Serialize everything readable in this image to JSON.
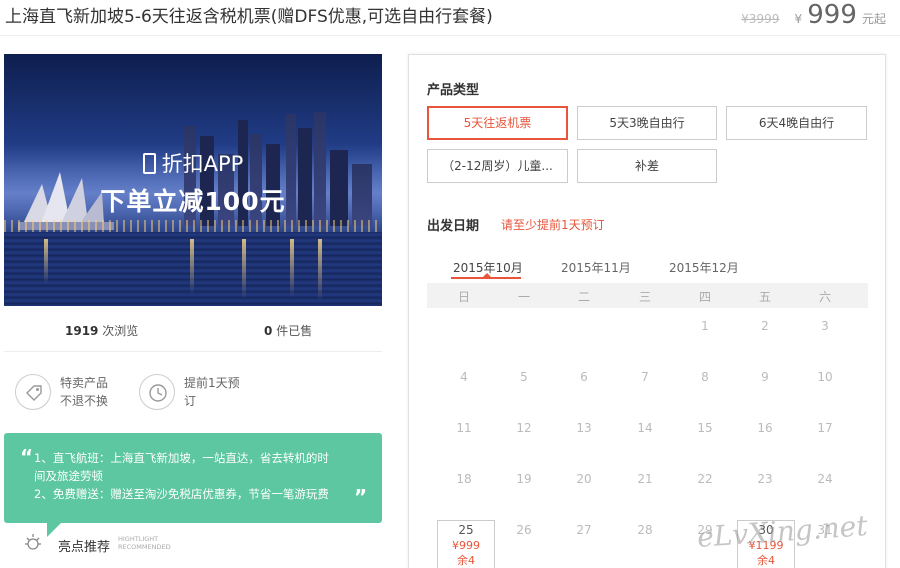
{
  "header": {
    "title": "上海直飞新加坡5-6天往返含税机票(赠DFS优惠,可选自由行套餐)",
    "old_price": "¥3999",
    "currency": "¥",
    "price": "999",
    "price_suffix": "元起"
  },
  "banner": {
    "line1": "折扣APP",
    "line2": "下单立减100元"
  },
  "stats": {
    "views_count": "1919",
    "views_label": "次浏览",
    "sold_count": "0",
    "sold_label": "件已售"
  },
  "features": [
    {
      "icon": "tag-icon",
      "line1": "特卖产品",
      "line2": "不退不换"
    },
    {
      "icon": "clock-icon",
      "line1": "提前1天预",
      "line2": "订"
    }
  ],
  "highlights": {
    "line1": "1、直飞航班：上海直飞新加坡，一站直达，省去转机的时",
    "line2": "间及旅途劳顿",
    "line3": "2、免费赠送：赠送至淘沙免税店优惠券，节省一笔游玩费",
    "label": "亮点推荐",
    "label_en_1": "HIGHTLIGHT",
    "label_en_2": "RECOMMENDED"
  },
  "product_type": {
    "title": "产品类型",
    "options": [
      "5天往返机票",
      "5天3晚自由行",
      "6天4晚自由行",
      "（2-12周岁）儿童...",
      "补差"
    ],
    "selected_index": 0
  },
  "departure": {
    "title": "出发日期",
    "hint": "请至少提前1天预订",
    "months": [
      "2015年10月",
      "2015年11月",
      "2015年12月"
    ],
    "active_month": 0,
    "weekdays": [
      "日",
      "一",
      "二",
      "三",
      "四",
      "五",
      "六"
    ],
    "days": {
      "d1": "1",
      "d2": "2",
      "d3": "3",
      "d4": "4",
      "d5": "5",
      "d6": "6",
      "d7": "7",
      "d8": "8",
      "d9": "9",
      "d10": "10",
      "d11": "11",
      "d12": "12",
      "d13": "13",
      "d14": "14",
      "d15": "15",
      "d16": "16",
      "d17": "17",
      "d18": "18",
      "d19": "19",
      "d20": "20",
      "d21": "21",
      "d22": "22",
      "d23": "23",
      "d24": "24",
      "d26": "26",
      "d27": "27",
      "d28": "28",
      "d29": "29",
      "d31": "31"
    },
    "available": [
      {
        "day": "25",
        "price": "¥999",
        "stock": "余4"
      },
      {
        "day": "30",
        "price": "¥1199",
        "stock": "余4"
      }
    ]
  },
  "watermark": "eLvXing.net",
  "colors": {
    "accent": "#e8553a",
    "highlight_bg": "#5cc7a0"
  }
}
